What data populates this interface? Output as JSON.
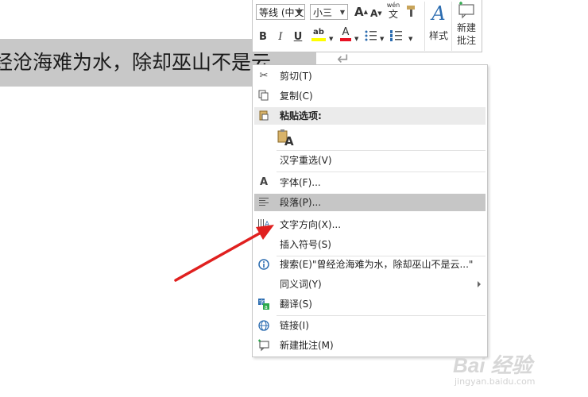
{
  "document": {
    "text": "经沧海难为水，除却巫山不是云",
    "paragraph_mark": "↵"
  },
  "mini_toolbar": {
    "font_name": "等线 (中文",
    "font_size": "小三",
    "grow_font": "A",
    "shrink_font": "A",
    "phonetic_top": "wén",
    "phonetic_bottom": "文",
    "bold": "B",
    "italic": "I",
    "underline": "U",
    "highlight": "ab",
    "font_color": "A",
    "styles_label": "样式",
    "new_comment_label_1": "新建",
    "new_comment_label_2": "批注"
  },
  "context_menu": {
    "items": [
      {
        "label": "剪切(T)",
        "icon": "scissors-icon"
      },
      {
        "label": "复制(C)",
        "icon": "copy-icon"
      },
      {
        "label": "粘贴选项:",
        "icon": "clipboard-icon"
      },
      {
        "label": "汉字重选(V)",
        "icon": ""
      },
      {
        "label": "字体(F)...",
        "icon": "font-icon"
      },
      {
        "label": "段落(P)...",
        "icon": "paragraph-icon"
      },
      {
        "label": "文字方向(X)...",
        "icon": "text-direction-icon"
      },
      {
        "label": "插入符号(S)",
        "icon": ""
      },
      {
        "label": "搜索(E)\"曾经沧海难为水，除却巫山不是云...\"",
        "icon": "search-icon"
      },
      {
        "label": "同义词(Y)",
        "icon": ""
      },
      {
        "label": "翻译(S)",
        "icon": "translate-icon"
      },
      {
        "label": "链接(I)",
        "icon": "link-icon"
      },
      {
        "label": "新建批注(M)",
        "icon": "comment-icon"
      }
    ],
    "paste_option_letter": "A"
  },
  "watermark": {
    "brand": "Bai 经验",
    "url": "jingyan.baidu.com"
  },
  "colors": {
    "highlight_row": "#c6c6c6",
    "arrow": "#e0201f",
    "font_color_bar": "#e81123",
    "highlight_bar": "#ffff00",
    "accent_blue": "#2b6cb0"
  }
}
